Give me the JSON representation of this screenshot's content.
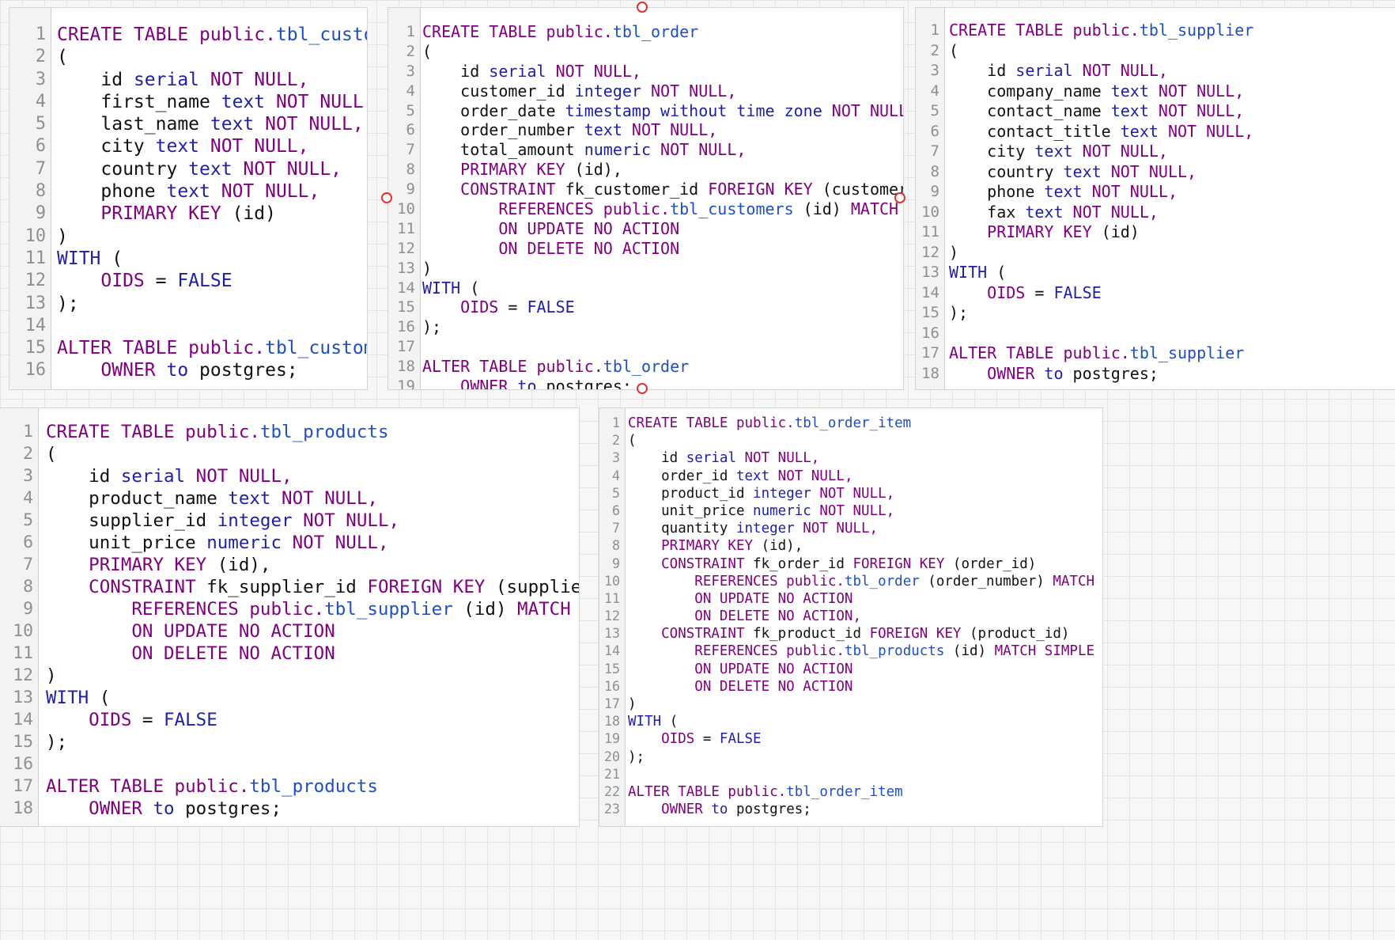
{
  "panels": [
    {
      "name": "tbl-customers",
      "lines": [
        [
          [
            "CREATE TABLE public.",
            "kw"
          ],
          [
            "tbl_customers",
            "id"
          ]
        ],
        [
          [
            "(",
            "pl"
          ]
        ],
        [
          [
            "    id ",
            "pl"
          ],
          [
            "serial",
            "ty"
          ],
          [
            " NOT NULL,",
            "kw"
          ]
        ],
        [
          [
            "    first_name ",
            "pl"
          ],
          [
            "text",
            "ty"
          ],
          [
            " NOT NULL,",
            "kw"
          ]
        ],
        [
          [
            "    last_name ",
            "pl"
          ],
          [
            "text",
            "ty"
          ],
          [
            " NOT NULL,",
            "kw"
          ]
        ],
        [
          [
            "    city ",
            "pl"
          ],
          [
            "text",
            "ty"
          ],
          [
            " NOT NULL,",
            "kw"
          ]
        ],
        [
          [
            "    country ",
            "pl"
          ],
          [
            "text",
            "ty"
          ],
          [
            " NOT NULL,",
            "kw"
          ]
        ],
        [
          [
            "    phone ",
            "pl"
          ],
          [
            "text",
            "ty"
          ],
          [
            " NOT NULL,",
            "kw"
          ]
        ],
        [
          [
            "    PRIMARY KEY ",
            "kw"
          ],
          [
            "(id)",
            "pl"
          ]
        ],
        [
          [
            ")",
            "pl"
          ]
        ],
        [
          [
            "WITH",
            "ty"
          ],
          [
            " (",
            "pl"
          ]
        ],
        [
          [
            "    OIDS",
            "kw"
          ],
          [
            " = ",
            "pl"
          ],
          [
            "FALSE",
            "ty"
          ]
        ],
        [
          [
            ");",
            "pl"
          ]
        ],
        [
          [
            "",
            "pl"
          ]
        ],
        [
          [
            "ALTER TABLE public.",
            "kw"
          ],
          [
            "tbl_customers",
            "id"
          ]
        ],
        [
          [
            "    OWNER",
            "kw"
          ],
          [
            " to ",
            "ty"
          ],
          [
            "postgres;",
            "pl"
          ]
        ]
      ]
    },
    {
      "name": "tbl-order",
      "lines": [
        [
          [
            "CREATE TABLE public.",
            "kw"
          ],
          [
            "tbl_order",
            "id"
          ]
        ],
        [
          [
            "(",
            "pl"
          ]
        ],
        [
          [
            "    id ",
            "pl"
          ],
          [
            "serial",
            "ty"
          ],
          [
            " NOT NULL,",
            "kw"
          ]
        ],
        [
          [
            "    customer_id ",
            "pl"
          ],
          [
            "integer",
            "ty"
          ],
          [
            " NOT NULL,",
            "kw"
          ]
        ],
        [
          [
            "    order_date ",
            "pl"
          ],
          [
            "timestamp without time zone",
            "ty"
          ],
          [
            " NOT NULL,",
            "kw"
          ]
        ],
        [
          [
            "    order_number ",
            "pl"
          ],
          [
            "text",
            "ty"
          ],
          [
            " NOT NULL,",
            "kw"
          ]
        ],
        [
          [
            "    total_amount ",
            "pl"
          ],
          [
            "numeric",
            "ty"
          ],
          [
            " NOT NULL,",
            "kw"
          ]
        ],
        [
          [
            "    PRIMARY KEY ",
            "kw"
          ],
          [
            "(id),",
            "pl"
          ]
        ],
        [
          [
            "    CONSTRAINT ",
            "kw"
          ],
          [
            "fk_customer_id ",
            "pl"
          ],
          [
            "FOREIGN KEY ",
            "kw"
          ],
          [
            "(customer_id)",
            "pl"
          ]
        ],
        [
          [
            "        REFERENCES public.",
            "kw"
          ],
          [
            "tbl_customers",
            "id"
          ],
          [
            " (id) ",
            "pl"
          ],
          [
            "MATCH SIMPLE",
            "kw"
          ]
        ],
        [
          [
            "        ON UPDATE NO ACTION",
            "kw"
          ]
        ],
        [
          [
            "        ON DELETE NO ACTION",
            "kw"
          ]
        ],
        [
          [
            ")",
            "pl"
          ]
        ],
        [
          [
            "WITH",
            "ty"
          ],
          [
            " (",
            "pl"
          ]
        ],
        [
          [
            "    OIDS",
            "kw"
          ],
          [
            " = ",
            "pl"
          ],
          [
            "FALSE",
            "ty"
          ]
        ],
        [
          [
            ");",
            "pl"
          ]
        ],
        [
          [
            "",
            "pl"
          ]
        ],
        [
          [
            "ALTER TABLE public.",
            "kw"
          ],
          [
            "tbl_order",
            "id"
          ]
        ],
        [
          [
            "    OWNER",
            "kw"
          ],
          [
            " to ",
            "ty"
          ],
          [
            "postgres;",
            "pl"
          ]
        ]
      ]
    },
    {
      "name": "tbl-supplier",
      "lines": [
        [
          [
            "CREATE TABLE public.",
            "kw"
          ],
          [
            "tbl_supplier",
            "id"
          ]
        ],
        [
          [
            "(",
            "pl"
          ]
        ],
        [
          [
            "    id ",
            "pl"
          ],
          [
            "serial",
            "ty"
          ],
          [
            " NOT NULL,",
            "kw"
          ]
        ],
        [
          [
            "    company_name ",
            "pl"
          ],
          [
            "text",
            "ty"
          ],
          [
            " NOT NULL,",
            "kw"
          ]
        ],
        [
          [
            "    contact_name ",
            "pl"
          ],
          [
            "text",
            "ty"
          ],
          [
            " NOT NULL,",
            "kw"
          ]
        ],
        [
          [
            "    contact_title ",
            "pl"
          ],
          [
            "text",
            "ty"
          ],
          [
            " NOT NULL,",
            "kw"
          ]
        ],
        [
          [
            "    city ",
            "pl"
          ],
          [
            "text",
            "ty"
          ],
          [
            " NOT NULL,",
            "kw"
          ]
        ],
        [
          [
            "    country ",
            "pl"
          ],
          [
            "text",
            "ty"
          ],
          [
            " NOT NULL,",
            "kw"
          ]
        ],
        [
          [
            "    phone ",
            "pl"
          ],
          [
            "text",
            "ty"
          ],
          [
            " NOT NULL,",
            "kw"
          ]
        ],
        [
          [
            "    fax ",
            "pl"
          ],
          [
            "text",
            "ty"
          ],
          [
            " NOT NULL,",
            "kw"
          ]
        ],
        [
          [
            "    PRIMARY KEY ",
            "kw"
          ],
          [
            "(id)",
            "pl"
          ]
        ],
        [
          [
            ")",
            "pl"
          ]
        ],
        [
          [
            "WITH",
            "ty"
          ],
          [
            " (",
            "pl"
          ]
        ],
        [
          [
            "    OIDS",
            "kw"
          ],
          [
            " = ",
            "pl"
          ],
          [
            "FALSE",
            "ty"
          ]
        ],
        [
          [
            ");",
            "pl"
          ]
        ],
        [
          [
            "",
            "pl"
          ]
        ],
        [
          [
            "ALTER TABLE public.",
            "kw"
          ],
          [
            "tbl_supplier",
            "id"
          ]
        ],
        [
          [
            "    OWNER",
            "kw"
          ],
          [
            " to ",
            "ty"
          ],
          [
            "postgres;",
            "pl"
          ]
        ]
      ]
    },
    {
      "name": "tbl-products",
      "lines": [
        [
          [
            "CREATE TABLE public.",
            "kw"
          ],
          [
            "tbl_products",
            "id"
          ]
        ],
        [
          [
            "(",
            "pl"
          ]
        ],
        [
          [
            "    id ",
            "pl"
          ],
          [
            "serial",
            "ty"
          ],
          [
            " NOT NULL,",
            "kw"
          ]
        ],
        [
          [
            "    product_name ",
            "pl"
          ],
          [
            "text",
            "ty"
          ],
          [
            " NOT NULL,",
            "kw"
          ]
        ],
        [
          [
            "    supplier_id ",
            "pl"
          ],
          [
            "integer",
            "ty"
          ],
          [
            " NOT NULL,",
            "kw"
          ]
        ],
        [
          [
            "    unit_price ",
            "pl"
          ],
          [
            "numeric",
            "ty"
          ],
          [
            " NOT NULL,",
            "kw"
          ]
        ],
        [
          [
            "    PRIMARY KEY ",
            "kw"
          ],
          [
            "(id),",
            "pl"
          ]
        ],
        [
          [
            "    CONSTRAINT ",
            "kw"
          ],
          [
            "fk_supplier_id ",
            "pl"
          ],
          [
            "FOREIGN KEY ",
            "kw"
          ],
          [
            "(supplier_id)",
            "pl"
          ]
        ],
        [
          [
            "        REFERENCES public.",
            "kw"
          ],
          [
            "tbl_supplier",
            "id"
          ],
          [
            " (id) ",
            "pl"
          ],
          [
            "MATCH SIMPLE",
            "kw"
          ]
        ],
        [
          [
            "        ON UPDATE NO ACTION",
            "kw"
          ]
        ],
        [
          [
            "        ON DELETE NO ACTION",
            "kw"
          ]
        ],
        [
          [
            ")",
            "pl"
          ]
        ],
        [
          [
            "WITH",
            "ty"
          ],
          [
            " (",
            "pl"
          ]
        ],
        [
          [
            "    OIDS",
            "kw"
          ],
          [
            " = ",
            "pl"
          ],
          [
            "FALSE",
            "ty"
          ]
        ],
        [
          [
            ");",
            "pl"
          ]
        ],
        [
          [
            "",
            "pl"
          ]
        ],
        [
          [
            "ALTER TABLE public.",
            "kw"
          ],
          [
            "tbl_products",
            "id"
          ]
        ],
        [
          [
            "    OWNER",
            "kw"
          ],
          [
            " to ",
            "ty"
          ],
          [
            "postgres;",
            "pl"
          ]
        ]
      ]
    },
    {
      "name": "tbl-order-item",
      "lines": [
        [
          [
            "CREATE TABLE public.",
            "kw"
          ],
          [
            "tbl_order_item",
            "id"
          ]
        ],
        [
          [
            "(",
            "pl"
          ]
        ],
        [
          [
            "    id ",
            "pl"
          ],
          [
            "serial",
            "ty"
          ],
          [
            " NOT NULL,",
            "kw"
          ]
        ],
        [
          [
            "    order_id ",
            "pl"
          ],
          [
            "text",
            "ty"
          ],
          [
            " NOT NULL,",
            "kw"
          ]
        ],
        [
          [
            "    product_id ",
            "pl"
          ],
          [
            "integer",
            "ty"
          ],
          [
            " NOT NULL,",
            "kw"
          ]
        ],
        [
          [
            "    unit_price ",
            "pl"
          ],
          [
            "numeric",
            "ty"
          ],
          [
            " NOT NULL,",
            "kw"
          ]
        ],
        [
          [
            "    quantity ",
            "pl"
          ],
          [
            "integer",
            "ty"
          ],
          [
            " NOT NULL,",
            "kw"
          ]
        ],
        [
          [
            "    PRIMARY KEY ",
            "kw"
          ],
          [
            "(id),",
            "pl"
          ]
        ],
        [
          [
            "    CONSTRAINT ",
            "kw"
          ],
          [
            "fk_order_id ",
            "pl"
          ],
          [
            "FOREIGN KEY ",
            "kw"
          ],
          [
            "(order_id)",
            "pl"
          ]
        ],
        [
          [
            "        REFERENCES public.",
            "kw"
          ],
          [
            "tbl_order",
            "id"
          ],
          [
            " (order_number) ",
            "pl"
          ],
          [
            "MATCH SIMPLE",
            "kw"
          ]
        ],
        [
          [
            "        ON UPDATE NO ACTION",
            "kw"
          ]
        ],
        [
          [
            "        ON DELETE NO ACTION,",
            "kw"
          ]
        ],
        [
          [
            "    CONSTRAINT ",
            "kw"
          ],
          [
            "fk_product_id ",
            "pl"
          ],
          [
            "FOREIGN KEY ",
            "kw"
          ],
          [
            "(product_id)",
            "pl"
          ]
        ],
        [
          [
            "        REFERENCES public.",
            "kw"
          ],
          [
            "tbl_products",
            "id"
          ],
          [
            " (id) ",
            "pl"
          ],
          [
            "MATCH SIMPLE",
            "kw"
          ]
        ],
        [
          [
            "        ON UPDATE NO ACTION",
            "kw"
          ]
        ],
        [
          [
            "        ON DELETE NO ACTION",
            "kw"
          ]
        ],
        [
          [
            ")",
            "pl"
          ]
        ],
        [
          [
            "WITH",
            "ty"
          ],
          [
            " (",
            "pl"
          ]
        ],
        [
          [
            "    OIDS",
            "kw"
          ],
          [
            " = ",
            "pl"
          ],
          [
            "FALSE",
            "ty"
          ]
        ],
        [
          [
            ");",
            "pl"
          ]
        ],
        [
          [
            "",
            "pl"
          ]
        ],
        [
          [
            "ALTER TABLE public.",
            "kw"
          ],
          [
            "tbl_order_item",
            "id"
          ]
        ],
        [
          [
            "    OWNER",
            "kw"
          ],
          [
            " to ",
            "ty"
          ],
          [
            "postgres;",
            "pl"
          ]
        ]
      ]
    }
  ],
  "colors": {
    "keyword": "#800080",
    "type": "#1f1fa6",
    "identifier": "#1f4fbf",
    "plain": "#111111",
    "selection_handle": "#e03030"
  }
}
